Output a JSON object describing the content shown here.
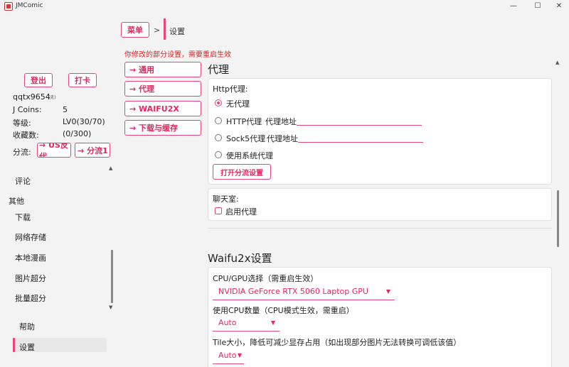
{
  "window": {
    "title": "JMComic",
    "min": "—",
    "max": "☐",
    "close": "✕"
  },
  "breadcrumb": {
    "menu": "菜单",
    "separator": ">",
    "current": "设置"
  },
  "notice": "你修改的部分设置，需要重启生效",
  "nav": [
    {
      "label": "→ 通用"
    },
    {
      "label": "→ 代理"
    },
    {
      "label": "→ WAIFU2X"
    },
    {
      "label": "→ 下载与缓存"
    }
  ],
  "sidebar": {
    "logout": "登出",
    "checkin": "打卡",
    "username": "qqtx9654",
    "user_tag": "(无)",
    "coins_label": "J Coins:",
    "coins_value": "5",
    "level_label": "等级:",
    "level_value": "LV0(30/70)",
    "fav_label": "收藏数:",
    "fav_value": "(0/300)",
    "stream_label": "分流:",
    "stream_us": "→ US反代",
    "stream_1": "→ 分流1",
    "items": [
      {
        "label": "评论"
      },
      {
        "label": "其他"
      },
      {
        "label": "下载"
      },
      {
        "label": "网络存储"
      },
      {
        "label": "本地漫画"
      },
      {
        "label": "图片超分"
      },
      {
        "label": "批量超分"
      },
      {
        "label": "帮助"
      },
      {
        "label": "设置"
      }
    ]
  },
  "proxy": {
    "title": "代理",
    "http_label": "Http代理:",
    "options": [
      {
        "label": "无代理",
        "checked": true
      },
      {
        "label": "HTTP代理",
        "addr_label": "代理地址",
        "value": ""
      },
      {
        "label": "Sock5代理",
        "addr_label": "代理地址",
        "value": ""
      },
      {
        "label": "使用系统代理"
      }
    ],
    "open_stream_button": "打开分流设置",
    "chat_label": "聊天室:",
    "chat_checkbox": "启用代理",
    "chat_checked": false
  },
  "waifu": {
    "title": "Waifu2x设置",
    "gpu_label": "CPU/GPU选择（需重启生效）",
    "gpu_value": "NVIDIA GeForce RTX 5060 Laptop GPU",
    "cpu_count_label": "使用CPU数量（CPU模式生效，需重启）",
    "cpu_count_value": "Auto",
    "tile_label": "Tile大小，降低可减少显存占用（如出现部分图片无法转换可调低该值）",
    "tile_value": "Auto"
  },
  "colors": {
    "accent": "#e8477a",
    "warning": "#e02020"
  }
}
